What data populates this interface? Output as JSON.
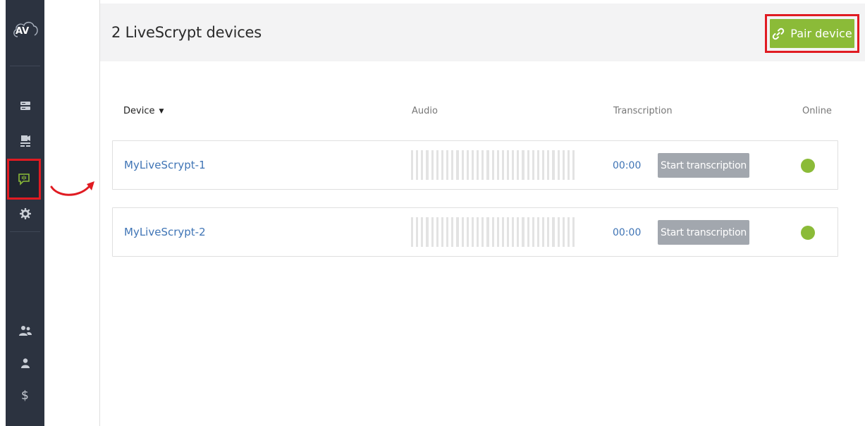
{
  "sidebar": {
    "logo_icon": "av-cloud-logo-icon",
    "items": [
      {
        "icon": "server-icon"
      },
      {
        "icon": "video-recorder-icon"
      },
      {
        "icon": "livescrypt-speech-icon",
        "active": true
      },
      {
        "icon": "gear-icon"
      },
      {
        "icon": "users-icon"
      },
      {
        "icon": "user-icon"
      },
      {
        "icon": "dollar-icon"
      }
    ]
  },
  "header": {
    "title": "2 LiveScrypt devices",
    "pair_label": "Pair device",
    "pair_icon": "link-icon"
  },
  "table": {
    "columns": {
      "device": "Device",
      "audio": "Audio",
      "transcription": "Transcription",
      "online": "Online"
    },
    "rows": [
      {
        "name": "MyLiveScrypt-1",
        "time": "00:00",
        "action": "Start transcription",
        "online": true
      },
      {
        "name": "MyLiveScrypt-2",
        "time": "00:00",
        "action": "Start transcription",
        "online": true
      }
    ]
  },
  "colors": {
    "sidebar_bg": "#2c3340",
    "accent_green": "#8bbb38",
    "link_blue": "#3f74b5",
    "highlight_red": "#e01b22",
    "button_gray": "#a2a7ae"
  }
}
